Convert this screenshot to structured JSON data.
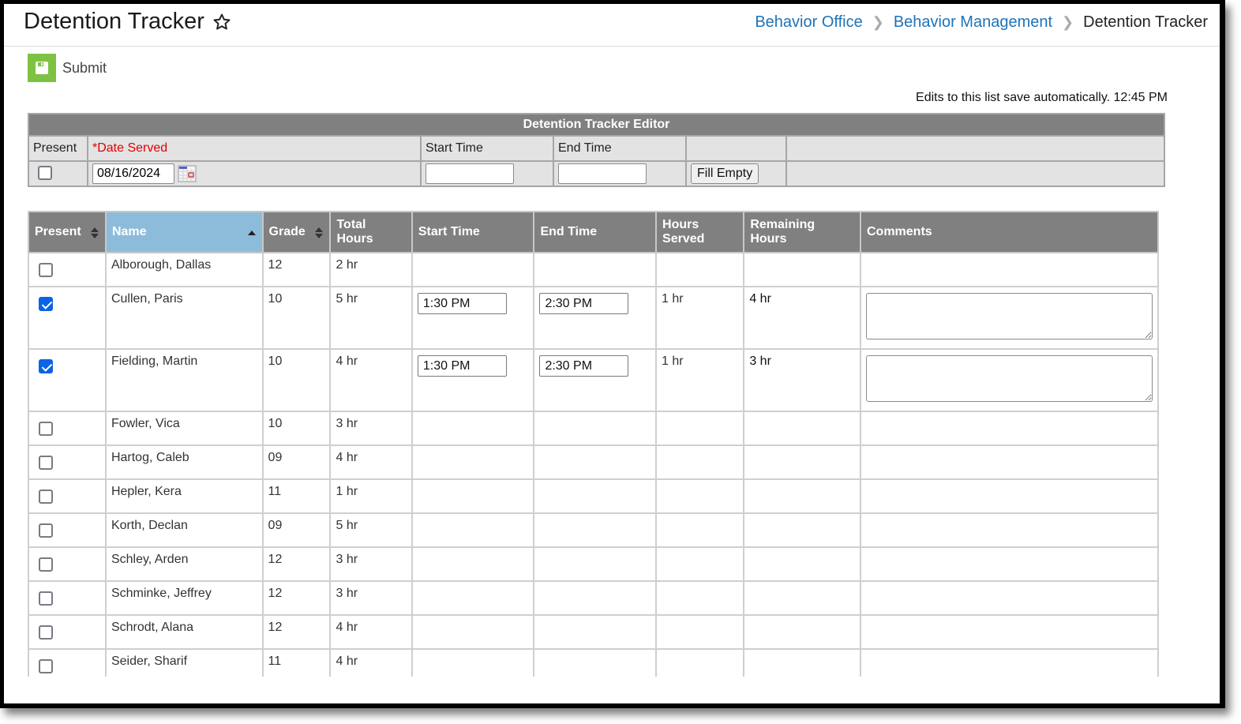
{
  "header": {
    "title": "Detention Tracker",
    "favorite_icon": "star-outline-icon",
    "breadcrumb": [
      "Behavior Office",
      "Behavior Management",
      "Detention Tracker"
    ]
  },
  "toolbar": {
    "submit_label": "Submit",
    "submit_icon": "save-icon",
    "submit_color": "#7dc242"
  },
  "autosave_text": "Edits to this list save automatically. 12:45 PM",
  "editor": {
    "title": "Detention Tracker Editor",
    "col_present": "Present",
    "col_date_served": "*Date Served",
    "col_start_time": "Start Time",
    "col_end_time": "End Time",
    "present_checked": false,
    "date_served_value": "08/16/2024",
    "start_time_value": "",
    "end_time_value": "",
    "fill_empty_label": "Fill Empty"
  },
  "grid": {
    "columns": [
      "Present",
      "Name",
      "Grade",
      "Total Hours",
      "Start Time",
      "End Time",
      "Hours Served",
      "Remaining Hours",
      "Comments"
    ],
    "sorted_column": "Name",
    "sorted_color": "#8dbcdb",
    "rows": [
      {
        "present": false,
        "name": "Alborough, Dallas",
        "grade": "12",
        "total_hours": "2 hr",
        "start_time": "",
        "end_time": "",
        "hours_served": "",
        "remaining_hours": "",
        "comments": ""
      },
      {
        "present": true,
        "name": "Cullen, Paris",
        "grade": "10",
        "total_hours": "5 hr",
        "start_time": "1:30 PM",
        "end_time": "2:30 PM",
        "hours_served": "1 hr",
        "remaining_hours": "4 hr",
        "comments": ""
      },
      {
        "present": true,
        "name": "Fielding, Martin",
        "grade": "10",
        "total_hours": "4 hr",
        "start_time": "1:30 PM",
        "end_time": "2:30 PM",
        "hours_served": "1 hr",
        "remaining_hours": "3 hr",
        "comments": ""
      },
      {
        "present": false,
        "name": "Fowler, Vica",
        "grade": "10",
        "total_hours": "3 hr",
        "start_time": "",
        "end_time": "",
        "hours_served": "",
        "remaining_hours": "",
        "comments": ""
      },
      {
        "present": false,
        "name": "Hartog, Caleb",
        "grade": "09",
        "total_hours": "4 hr",
        "start_time": "",
        "end_time": "",
        "hours_served": "",
        "remaining_hours": "",
        "comments": ""
      },
      {
        "present": false,
        "name": "Hepler, Kera",
        "grade": "11",
        "total_hours": "1 hr",
        "start_time": "",
        "end_time": "",
        "hours_served": "",
        "remaining_hours": "",
        "comments": ""
      },
      {
        "present": false,
        "name": "Korth, Declan",
        "grade": "09",
        "total_hours": "5 hr",
        "start_time": "",
        "end_time": "",
        "hours_served": "",
        "remaining_hours": "",
        "comments": ""
      },
      {
        "present": false,
        "name": "Schley, Arden",
        "grade": "12",
        "total_hours": "3 hr",
        "start_time": "",
        "end_time": "",
        "hours_served": "",
        "remaining_hours": "",
        "comments": ""
      },
      {
        "present": false,
        "name": "Schminke, Jeffrey",
        "grade": "12",
        "total_hours": "3 hr",
        "start_time": "",
        "end_time": "",
        "hours_served": "",
        "remaining_hours": "",
        "comments": ""
      },
      {
        "present": false,
        "name": "Schrodt, Alana",
        "grade": "12",
        "total_hours": "4 hr",
        "start_time": "",
        "end_time": "",
        "hours_served": "",
        "remaining_hours": "",
        "comments": ""
      },
      {
        "present": false,
        "name": "Seider, Sharif",
        "grade": "11",
        "total_hours": "4 hr",
        "start_time": "",
        "end_time": "",
        "hours_served": "",
        "remaining_hours": "",
        "comments": ""
      }
    ]
  }
}
